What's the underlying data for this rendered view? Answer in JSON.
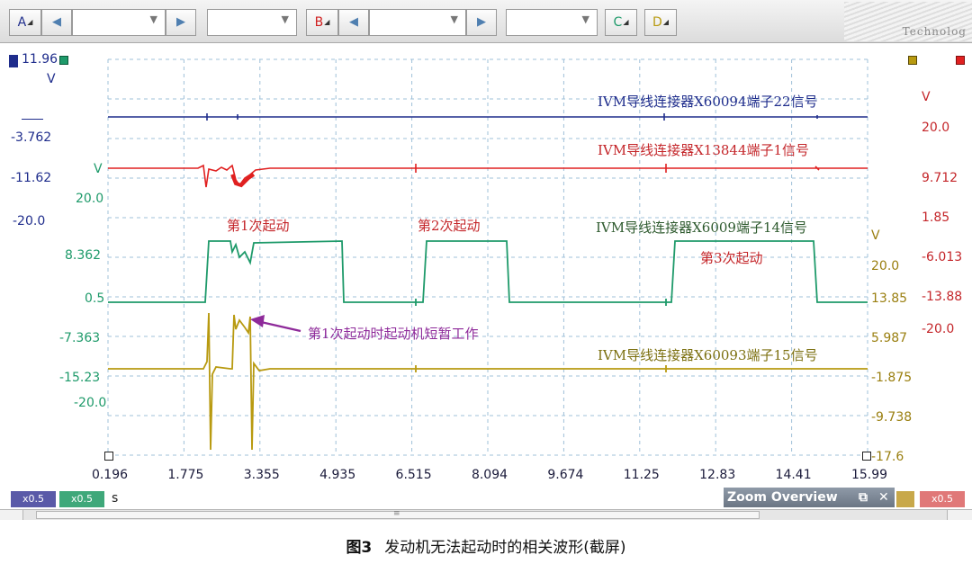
{
  "toolbar": {
    "channel_a": "A",
    "channel_b": "B",
    "channel_c": "C",
    "channel_d": "D",
    "brand": "Technolog"
  },
  "colors": {
    "channel_a": "#1f2d8c",
    "channel_b": "#e02020",
    "channel_c": "#1e9a6a",
    "channel_d": "#b89a10",
    "annotation": "#8e2a9a",
    "label_red": "#c4262a",
    "label_green": "#2e5a2e",
    "label_olive": "#7c7010"
  },
  "axis_left_a": {
    "top": "11.96",
    "unit": "V",
    "ticks": [
      "-3.762",
      "-11.62",
      "-20.0"
    ]
  },
  "axis_left_c": {
    "unit": "V",
    "ticks": [
      "20.0",
      "8.362",
      "0.5",
      "-7.363",
      "-15.23",
      "-20.0"
    ]
  },
  "axis_right_d": {
    "unit": "V",
    "ticks": [
      "20.0",
      "13.85",
      "5.987",
      "-1.875",
      "-9.738",
      "-17.6"
    ]
  },
  "axis_right_b": {
    "unit": "V",
    "ticks": [
      "20.0",
      "9.712",
      "1.85",
      "-6.013",
      "-13.88",
      "-20.0"
    ]
  },
  "time_axis": {
    "unit": "s",
    "ticks": [
      "0.196",
      "1.775",
      "3.355",
      "4.935",
      "6.515",
      "8.094",
      "9.674",
      "11.25",
      "12.83",
      "14.41",
      "15.99"
    ]
  },
  "trace_labels": {
    "a": "IVM导线连接器X60094端子22信号",
    "b": "IVM导线连接器X13844端子1信号",
    "c": "IVM导线连接器X6009端子14信号",
    "d": "IVM导线连接器X60093端子15信号"
  },
  "annotations": {
    "start1": "第1次起动",
    "start2": "第2次起动",
    "start3": "第3次起动",
    "motor_note": "第1次起动时起动机短暂工作"
  },
  "bottom": {
    "scale_tabs": [
      "x0.5",
      "x0.5",
      "x0.5"
    ],
    "zoom_title": "Zoom Overview",
    "zoom_restore": "⧉",
    "zoom_close": "✕"
  },
  "caption": {
    "figure": "图3",
    "text": "发动机无法起动时的相关波形(截屏)"
  }
}
